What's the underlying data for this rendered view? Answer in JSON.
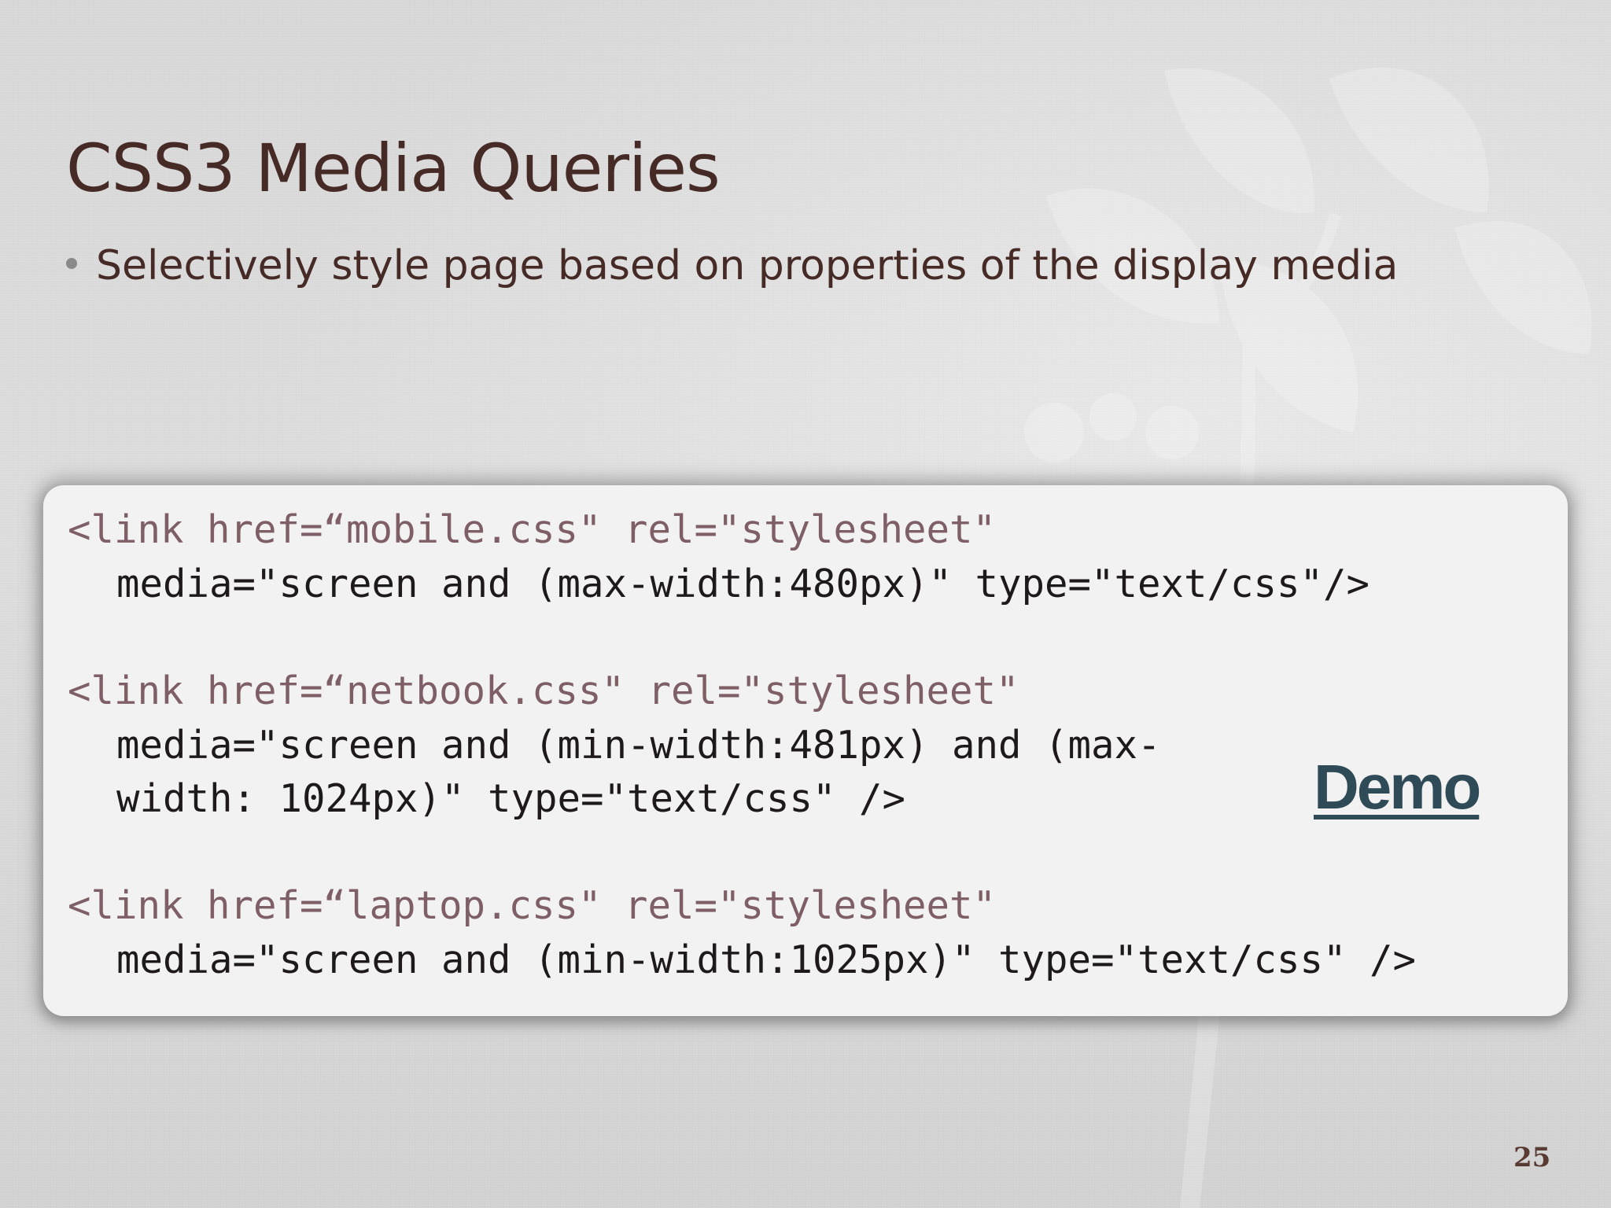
{
  "slide": {
    "title": "CSS3 Media Queries",
    "bullet": "Selectively style page based on properties of the display media",
    "code_lines": [
      "<link href=“mobile.css\" rel=\"stylesheet\"",
      "media=\"screen and (max-width:480px)\" type=\"text/css\"/>",
      "<link href=“netbook.css\" rel=\"stylesheet\"",
      "media=\"screen and (min-width:481px) and (max-",
      "width: 1024px)\" type=\"text/css\" />",
      "<link href=“laptop.css\" rel=\"stylesheet\"",
      "media=\"screen and (min-width:1025px)\" type=\"text/css\" />"
    ],
    "demo_link": "Demo",
    "page_number": "25"
  },
  "colors": {
    "title": "#452a26",
    "code_tag": "#7e5f66",
    "code_text": "#1e1a1b",
    "demo_link": "#2f4b57",
    "code_box_bg": "#f3f2f3"
  }
}
